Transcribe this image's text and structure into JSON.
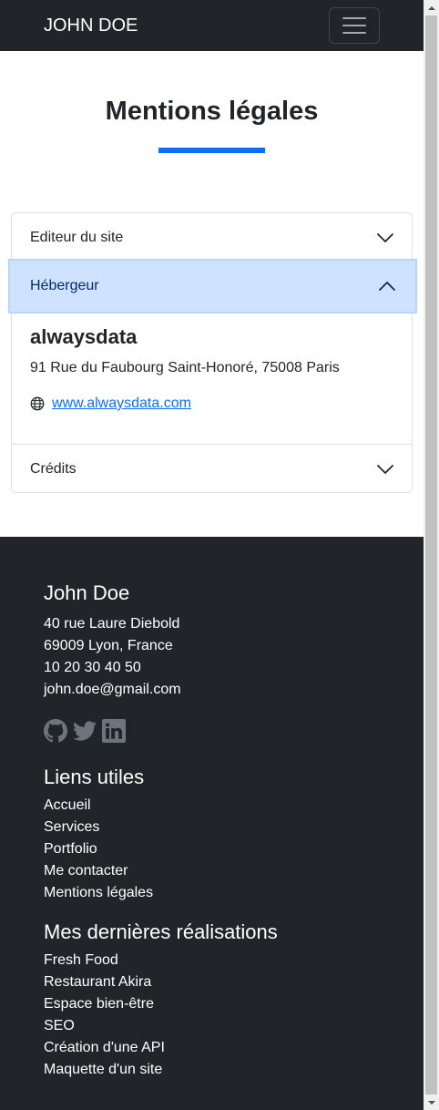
{
  "navbar": {
    "brand": "JOHN DOE",
    "toggle_icon": "hamburger-menu-icon"
  },
  "page": {
    "title": "Mentions légales",
    "accent_color": "#0d6efd"
  },
  "accordion": {
    "items": [
      {
        "label": "Editeur du site",
        "expanded": false
      },
      {
        "label": "Hébergeur",
        "expanded": true
      },
      {
        "label": "Crédits",
        "expanded": false
      }
    ],
    "host": {
      "name": "alwaysdata",
      "address": "91 Rue du Faubourg Saint-Honoré, 75008 Paris",
      "website": "www.alwaysdata.com"
    },
    "active_bg": "#cfe2ff"
  },
  "footer": {
    "name": "John Doe",
    "contact": [
      "40 rue Laure Diebold",
      "69009 Lyon, France",
      "10 20 30 40 50",
      "john.doe@gmail.com"
    ],
    "socials": [
      "github-icon",
      "twitter-icon",
      "linkedin-icon"
    ],
    "links_title": "Liens utiles",
    "links": [
      "Accueil",
      "Services",
      "Portfolio",
      "Me contacter",
      "Mentions légales"
    ],
    "projects_title": "Mes dernières réalisations",
    "projects": [
      "Fresh Food",
      "Restaurant Akira",
      "Espace bien-être",
      "SEO",
      "Création d'une API",
      "Maquette d'un site"
    ],
    "bg": "#212529"
  }
}
